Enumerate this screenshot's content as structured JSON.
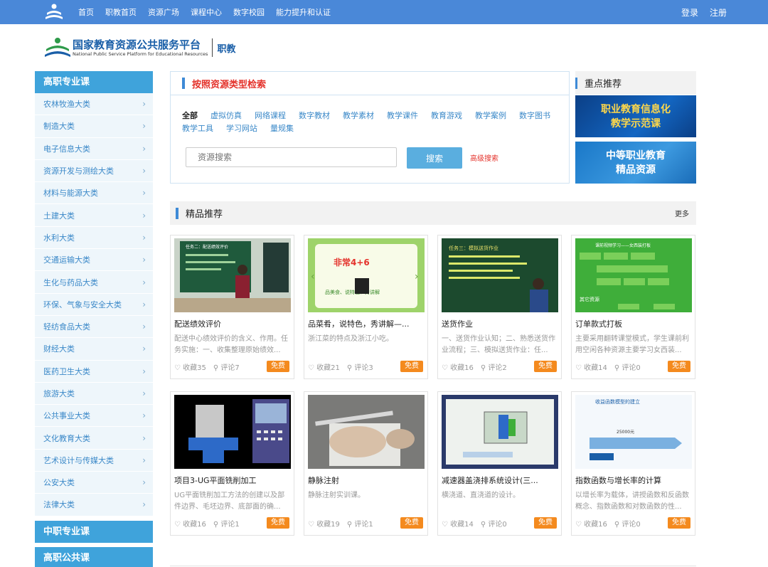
{
  "topnav": {
    "items": [
      "首页",
      "职教首页",
      "资源广场",
      "课程中心",
      "数字校园",
      "能力提升和认证"
    ],
    "login": "登录",
    "register": "注册"
  },
  "brand": {
    "cn": "国家教育资源公共服务平台",
    "en": "National Public Service Platform for Educational Resources",
    "sub": "职教"
  },
  "sidebar": {
    "head": "高职专业课",
    "items": [
      "农林牧渔大类",
      "制造大类",
      "电子信息大类",
      "资源开发与测绘大类",
      "材料与能源大类",
      "土建大类",
      "水利大类",
      "交通运输大类",
      "生化与药品大类",
      "环保、气象与安全大类",
      "轻纺食品大类",
      "财经大类",
      "医药卫生大类",
      "旅游大类",
      "公共事业大类",
      "文化教育大类",
      "艺术设计与传媒大类",
      "公安大类",
      "法律大类"
    ],
    "head2": "中职专业课",
    "head3": "高职公共课"
  },
  "search": {
    "title": "按照资源类型检索",
    "types": [
      "全部",
      "虚拟仿真",
      "网络课程",
      "数字教材",
      "教学素材",
      "教学课件",
      "教育游戏",
      "教学案例",
      "数字图书",
      "教学工具",
      "学习网站",
      "量规集"
    ],
    "placeholder": "资源搜索",
    "button": "搜索",
    "advanced": "高级搜索"
  },
  "recommend": {
    "title": "重点推荐",
    "banner1": [
      "职业教育信息化",
      "教学示范课"
    ],
    "banner2": [
      "中等职业教育",
      "精品资源"
    ]
  },
  "featured": {
    "title": "精品推荐",
    "more": "更多",
    "cards": [
      {
        "title": "配送绩效评价",
        "desc": "配送中心绩效评价的含义、作用。任务实施：一、收集整理原始绩效...",
        "fav": "收藏35",
        "comments": "评论7",
        "badge": "免费"
      },
      {
        "title": "品菜肴，说特色，秀讲解—...",
        "desc": "浙江菜的特点及浙江小吃。",
        "fav": "收藏21",
        "comments": "评论3",
        "badge": "免费"
      },
      {
        "title": "送货作业",
        "desc": "一、送货作业认知；二、熟悉送货作业流程；三、模拟送货作业：任...",
        "fav": "收藏16",
        "comments": "评论2",
        "badge": "免费"
      },
      {
        "title": "订单款式打板",
        "desc": "主要采用翻转课堂模式，学生课前利用空闲各种资源主要学习女西装...",
        "fav": "收藏14",
        "comments": "评论0",
        "badge": "免费"
      },
      {
        "title": "项目3-UG平面铣削加工",
        "desc": "UG平面铣削加工方法的创建以及部件边界、毛坯边界、底部面的确...",
        "fav": "收藏16",
        "comments": "评论1",
        "badge": "免费"
      },
      {
        "title": "静脉注射",
        "desc": "静脉注射实训课。",
        "fav": "收藏19",
        "comments": "评论1",
        "badge": "免费"
      },
      {
        "title": "减速器盖浇排系统设计(三...",
        "desc": "横浇道、直浇道的设计。",
        "fav": "收藏14",
        "comments": "评论0",
        "badge": "免费"
      },
      {
        "title": "指数函数与增长率的计算",
        "desc": "以增长率为载体，讲授函数和反函数概念、指数函数和对数函数的性...",
        "fav": "收藏16",
        "comments": "评论0",
        "badge": "免费"
      }
    ]
  },
  "thumb_text": {
    "t1": "任务二：配送绩效评价",
    "t2a": "非常4+6",
    "t2b": "品美食、说特色、秀讲解",
    "t3": "任务三：模拟送货作业",
    "t4a": "课前视频学习——女西装打板",
    "t4b": "其它资源",
    "t8a": "收益函数模型的建立",
    "t8b": "25000元"
  },
  "colors": {
    "topbar": "#4a88d8",
    "sidebar_head": "#3fa3db",
    "accent_red": "#e4322b",
    "badge": "#f48a1e"
  }
}
